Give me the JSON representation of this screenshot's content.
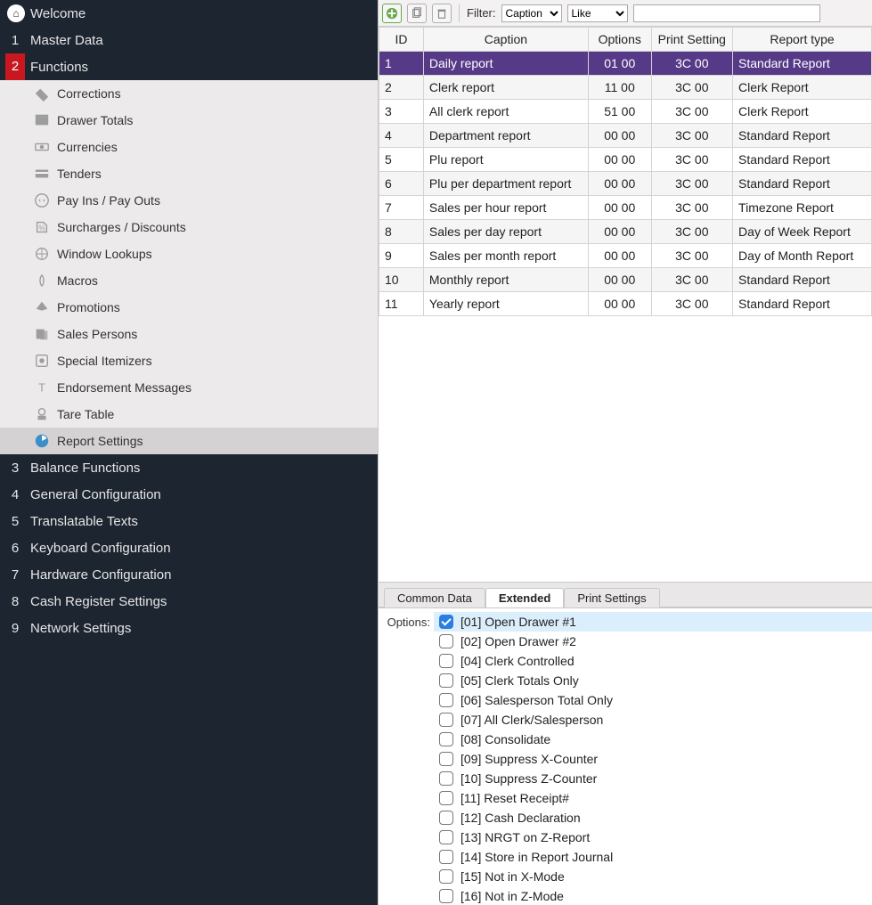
{
  "sidebar": {
    "welcome": "Welcome",
    "items": [
      {
        "num": "1",
        "label": "Master Data"
      },
      {
        "num": "2",
        "label": "Functions",
        "active": true
      },
      {
        "num": "3",
        "label": "Balance Functions"
      },
      {
        "num": "4",
        "label": "General Configuration"
      },
      {
        "num": "5",
        "label": "Translatable Texts"
      },
      {
        "num": "6",
        "label": "Keyboard Configuration"
      },
      {
        "num": "7",
        "label": "Hardware Configuration"
      },
      {
        "num": "8",
        "label": "Cash Register Settings"
      },
      {
        "num": "9",
        "label": "Network Settings"
      }
    ],
    "subitems": [
      {
        "label": "Corrections",
        "icon": "corrections"
      },
      {
        "label": "Drawer Totals",
        "icon": "drawer"
      },
      {
        "label": "Currencies",
        "icon": "currencies"
      },
      {
        "label": "Tenders",
        "icon": "tenders"
      },
      {
        "label": "Pay Ins / Pay Outs",
        "icon": "payinout"
      },
      {
        "label": "Surcharges / Discounts",
        "icon": "surcharge"
      },
      {
        "label": "Window Lookups",
        "icon": "lookup"
      },
      {
        "label": "Macros",
        "icon": "macros"
      },
      {
        "label": "Promotions",
        "icon": "promotions"
      },
      {
        "label": "Sales Persons",
        "icon": "salespersons"
      },
      {
        "label": "Special Itemizers",
        "icon": "itemizers"
      },
      {
        "label": "Endorsement Messages",
        "icon": "endorsement"
      },
      {
        "label": "Tare Table",
        "icon": "tare"
      },
      {
        "label": "Report Settings",
        "icon": "report",
        "selected": true
      }
    ]
  },
  "toolbar": {
    "filter_label": "Filter:",
    "filter_field": "Caption",
    "filter_op": "Like",
    "filter_value": ""
  },
  "grid": {
    "columns": [
      "ID",
      "Caption",
      "Options",
      "Print Setting",
      "Report type"
    ],
    "rows": [
      {
        "id": "1",
        "caption": "Daily report",
        "options": "01 00",
        "print": "3C 00",
        "type": "Standard Report",
        "selected": true
      },
      {
        "id": "2",
        "caption": "Clerk report",
        "options": "11 00",
        "print": "3C 00",
        "type": "Clerk Report"
      },
      {
        "id": "3",
        "caption": "All clerk report",
        "options": "51 00",
        "print": "3C 00",
        "type": "Clerk Report"
      },
      {
        "id": "4",
        "caption": "Department report",
        "options": "00 00",
        "print": "3C 00",
        "type": "Standard Report"
      },
      {
        "id": "5",
        "caption": "Plu report",
        "options": "00 00",
        "print": "3C 00",
        "type": "Standard Report"
      },
      {
        "id": "6",
        "caption": "Plu per department report",
        "options": "00 00",
        "print": "3C 00",
        "type": "Standard Report"
      },
      {
        "id": "7",
        "caption": "Sales per hour report",
        "options": "00 00",
        "print": "3C 00",
        "type": "Timezone Report"
      },
      {
        "id": "8",
        "caption": "Sales per day report",
        "options": "00 00",
        "print": "3C 00",
        "type": "Day of Week Report"
      },
      {
        "id": "9",
        "caption": "Sales per month report",
        "options": "00 00",
        "print": "3C 00",
        "type": "Day of Month Report"
      },
      {
        "id": "10",
        "caption": "Monthly report",
        "options": "00 00",
        "print": "3C 00",
        "type": "Standard Report"
      },
      {
        "id": "11",
        "caption": "Yearly report",
        "options": "00 00",
        "print": "3C 00",
        "type": "Standard Report"
      }
    ]
  },
  "tabs": {
    "items": [
      {
        "label": "Common Data"
      },
      {
        "label": "Extended",
        "active": true
      },
      {
        "label": "Print Settings"
      }
    ]
  },
  "options": {
    "label": "Options:",
    "items": [
      {
        "label": "[01] Open Drawer #1",
        "checked": true,
        "highlight": true
      },
      {
        "label": "[02] Open Drawer #2"
      },
      {
        "label": "[04] Clerk Controlled"
      },
      {
        "label": "[05] Clerk Totals Only"
      },
      {
        "label": "[06] Salesperson Total Only"
      },
      {
        "label": "[07] All Clerk/Salesperson"
      },
      {
        "label": "[08] Consolidate"
      },
      {
        "label": "[09] Suppress X-Counter"
      },
      {
        "label": "[10] Suppress Z-Counter"
      },
      {
        "label": "[11] Reset Receipt#"
      },
      {
        "label": "[12] Cash Declaration"
      },
      {
        "label": "[13] NRGT on Z-Report"
      },
      {
        "label": "[14] Store in Report Journal"
      },
      {
        "label": "[15] Not in X-Mode"
      },
      {
        "label": "[16] Not in Z-Mode"
      }
    ]
  }
}
